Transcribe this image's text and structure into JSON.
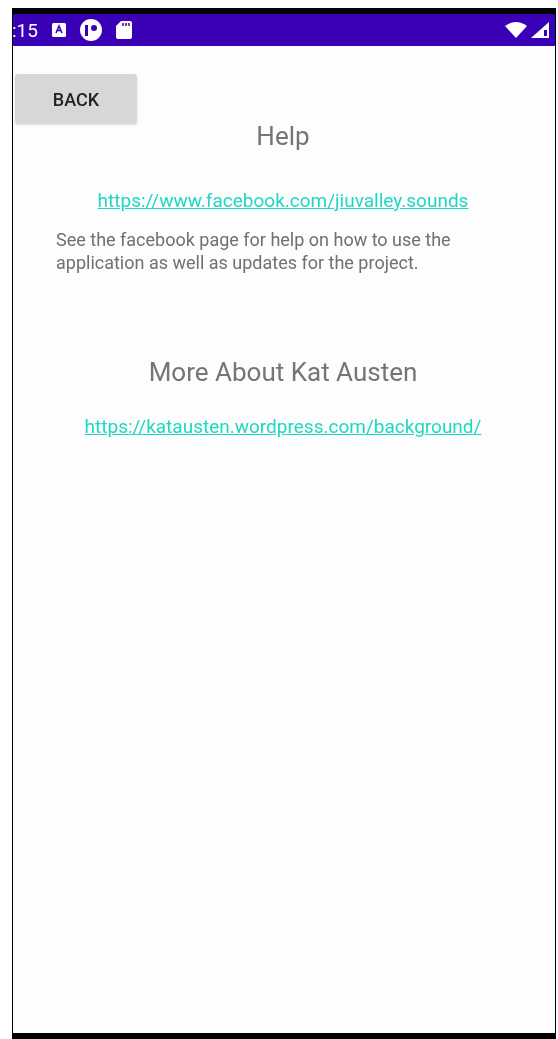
{
  "status_bar": {
    "time": ":15"
  },
  "back_button": {
    "label": "BACK"
  },
  "help": {
    "title": "Help",
    "link": "https://www.facebook.com/jiuvalley.sounds",
    "description": "See the facebook page for help on how to use the application as well as updates for the project."
  },
  "about": {
    "title": "More About Kat Austen",
    "link": "https://katausten.wordpress.com/background/"
  }
}
